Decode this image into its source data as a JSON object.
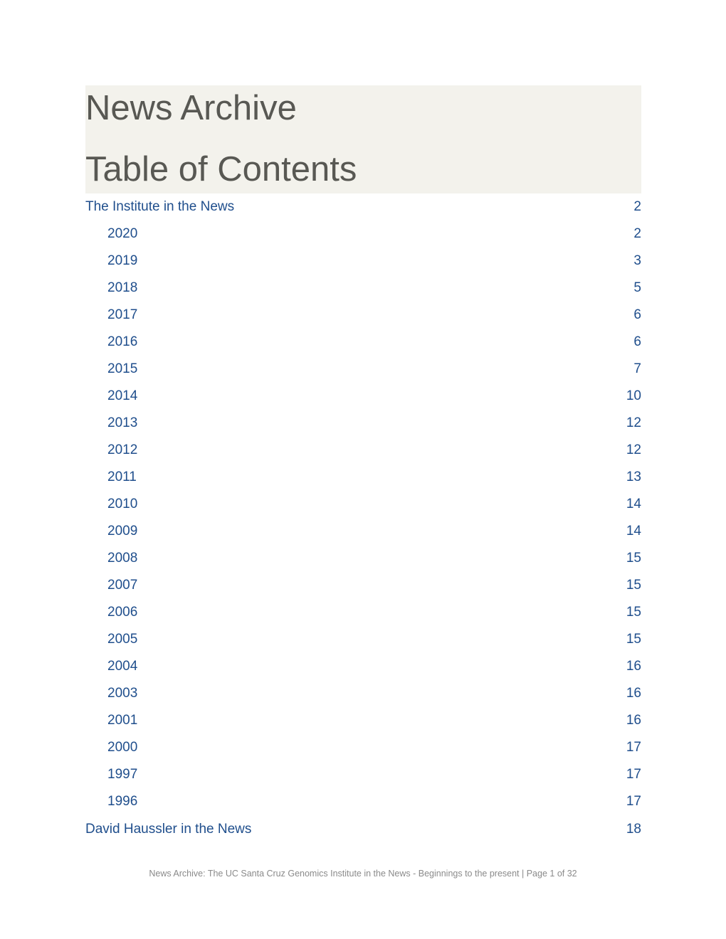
{
  "document": {
    "title_line_1": "News Archive",
    "title_line_2": "Table of Contents",
    "colors": {
      "title_text": "#585853",
      "title_background": "#f3f2ec",
      "link": "#1f4e8c",
      "footer_text": "#8a8a8a"
    }
  },
  "toc": {
    "entries": [
      {
        "label": "The Institute in the News",
        "page": "2",
        "level": 1
      },
      {
        "label": "2020",
        "page": "2",
        "level": 2
      },
      {
        "label": "2019",
        "page": "3",
        "level": 2
      },
      {
        "label": "2018",
        "page": "5",
        "level": 2
      },
      {
        "label": "2017",
        "page": "6",
        "level": 2
      },
      {
        "label": "2016",
        "page": "6",
        "level": 2
      },
      {
        "label": "2015",
        "page": "7",
        "level": 2
      },
      {
        "label": "2014",
        "page": "10",
        "level": 2
      },
      {
        "label": "2013",
        "page": "12",
        "level": 2
      },
      {
        "label": "2012",
        "page": "12",
        "level": 2
      },
      {
        "label": "2011",
        "page": "13",
        "level": 2
      },
      {
        "label": "2010",
        "page": "14",
        "level": 2
      },
      {
        "label": "2009",
        "page": "14",
        "level": 2
      },
      {
        "label": "2008",
        "page": "15",
        "level": 2
      },
      {
        "label": "2007",
        "page": "15",
        "level": 2
      },
      {
        "label": "2006",
        "page": "15",
        "level": 2
      },
      {
        "label": "2005",
        "page": "15",
        "level": 2
      },
      {
        "label": "2004",
        "page": "16",
        "level": 2
      },
      {
        "label": "2003",
        "page": "16",
        "level": 2
      },
      {
        "label": "2001",
        "page": "16",
        "level": 2
      },
      {
        "label": "2000",
        "page": "17",
        "level": 2
      },
      {
        "label": "1997",
        "page": "17",
        "level": 2
      },
      {
        "label": "1996",
        "page": "17",
        "level": 2
      },
      {
        "label": "David Haussler in the News",
        "page": "18",
        "level": 1
      }
    ]
  },
  "footer": {
    "text": "News Archive: The UC Santa Cruz Genomics Institute in the News - Beginnings to the present | Page 1 of 32"
  }
}
